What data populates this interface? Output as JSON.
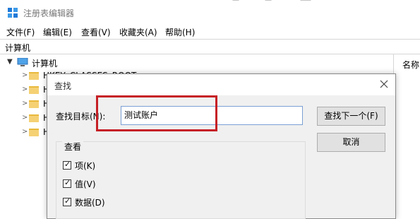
{
  "window": {
    "title": "注册表编辑器"
  },
  "menu": [
    {
      "label": "文件(F)"
    },
    {
      "label": "编辑(E)"
    },
    {
      "label": "查看(V)"
    },
    {
      "label": "收藏夹(A)"
    },
    {
      "label": "帮助(H)"
    }
  ],
  "address": {
    "path": "计算机"
  },
  "tree": {
    "root": {
      "label": "计算机"
    },
    "children": [
      {
        "label": "HKEY_CLASSES_ROOT"
      },
      {
        "label": "H"
      },
      {
        "label": "H"
      },
      {
        "label": "H"
      },
      {
        "label": "H"
      }
    ]
  },
  "list_pane": {
    "column_name": "名称"
  },
  "find_dialog": {
    "title": "查找",
    "find_what_label": "查找目标(N):",
    "find_what_value": "测试账户",
    "find_next_label": "查找下一个(F)",
    "cancel_label": "取消",
    "look_at_legend": "查看",
    "options": [
      {
        "label": "项(K)",
        "checked": true
      },
      {
        "label": "值(V)",
        "checked": true
      },
      {
        "label": "数据(D)",
        "checked": true
      }
    ]
  },
  "colors": {
    "annotation": "#c62026",
    "input_border": "#7a9fd4",
    "dialog_bg": "#f0f0f0"
  }
}
